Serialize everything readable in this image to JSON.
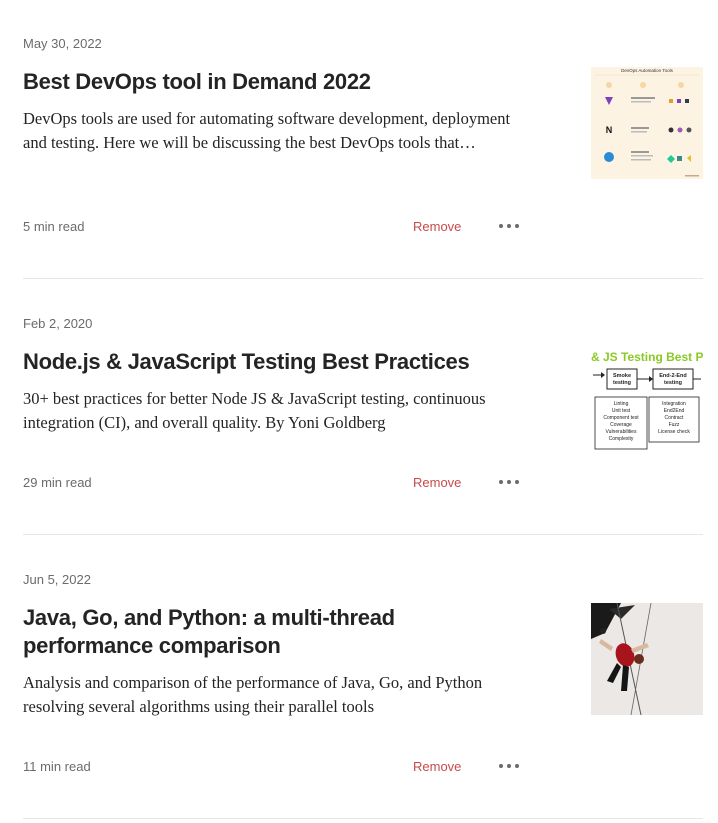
{
  "articles": [
    {
      "date": "May 30, 2022",
      "title": "Best DevOps tool in Demand 2022",
      "excerpt": "DevOps tools are used for automating software development, deployment and testing. Here we will be discussing the best DevOps tools that…",
      "read_time": "5 min read",
      "remove_label": "Remove",
      "thumb_icon": "devops-automation-tools-thumbnail"
    },
    {
      "date": "Feb 2, 2020",
      "title": "Node.js & JavaScript Testing Best Practices",
      "excerpt": "30+ best practices for better Node JS & JavaScript testing, continuous integration (CI), and overall quality. By Yoni Goldberg",
      "read_time": "29 min read",
      "remove_label": "Remove",
      "thumb_icon": "js-testing-diagram-thumbnail"
    },
    {
      "date": "Jun 5, 2022",
      "title": "Java, Go, and Python: a multi-thread performance comparison",
      "excerpt": "Analysis and comparison of the performance of Java, Go, and Python resolving several algorithms using their parallel tools",
      "read_time": "11 min read",
      "remove_label": "Remove",
      "thumb_icon": "aerial-acrobat-photo-thumbnail"
    }
  ],
  "thumb1": {
    "heading": "DevOps Automation Tools"
  },
  "thumb2": {
    "banner": "& JS Testing Best Pr",
    "box1": "Smoke testing",
    "box2": "End-2-End testing",
    "list1": [
      "Linting",
      "Unit test",
      "Component test",
      "Coverage",
      "Vulnerabilities",
      "Complexity"
    ],
    "list2": [
      "Integration",
      "End2End",
      "Contract",
      "Fuzz",
      "License check"
    ]
  },
  "colors": {
    "remove": "#c94a4a",
    "muted": "#6b6b6b",
    "divider": "#e6e6e6",
    "banner_green": "#8ac926"
  }
}
